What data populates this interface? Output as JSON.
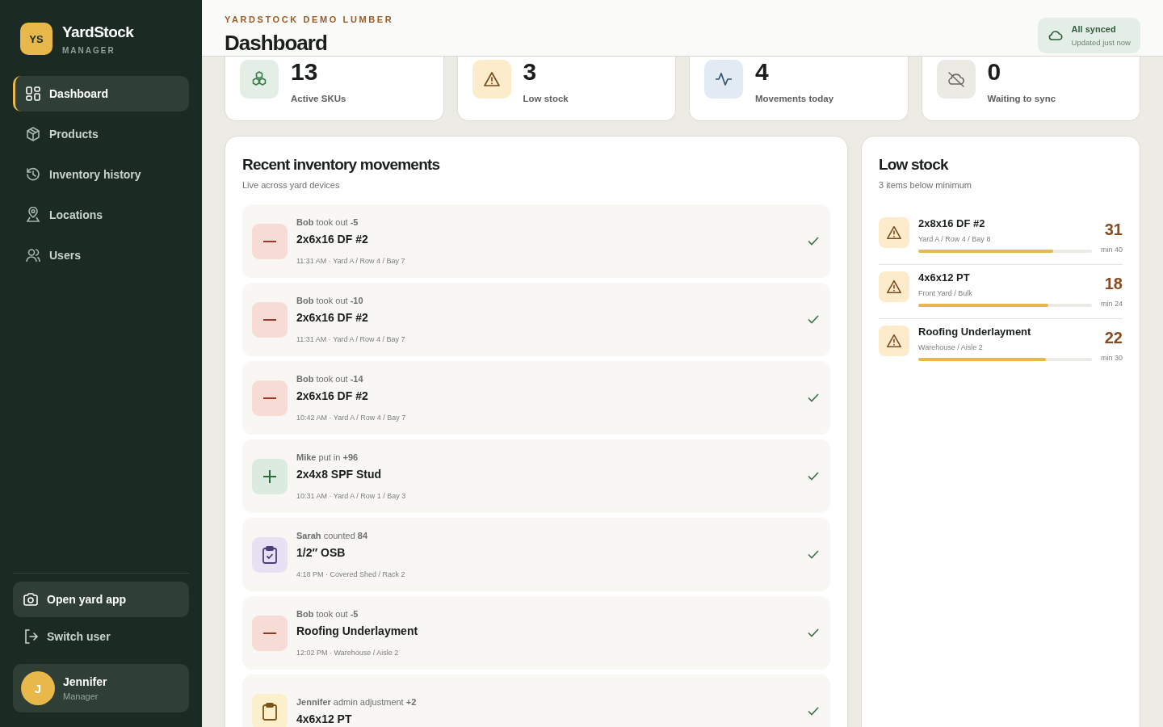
{
  "brand": {
    "logo": "YS",
    "name": "YardStock",
    "role": "MANAGER"
  },
  "nav": [
    {
      "label": "Dashboard",
      "selected": true
    },
    {
      "label": "Products",
      "selected": false
    },
    {
      "label": "Inventory history",
      "selected": false
    },
    {
      "label": "Locations",
      "selected": false
    },
    {
      "label": "Users",
      "selected": false
    }
  ],
  "open_app": "Open yard app",
  "switch_user": "Switch user",
  "user": {
    "initial": "J",
    "name": "Jennifer",
    "role": "Manager"
  },
  "header": {
    "company": "YARDSTOCK DEMO LUMBER",
    "title": "Dashboard",
    "sync": {
      "status": "All synced",
      "detail": "Updated just now"
    }
  },
  "stats": [
    {
      "kind": "skus",
      "value": "13",
      "label": "Active SKUs"
    },
    {
      "kind": "low",
      "value": "3",
      "label": "Low stock"
    },
    {
      "kind": "movements",
      "value": "4",
      "label": "Movements today"
    },
    {
      "kind": "pending",
      "value": "0",
      "label": "Waiting to sync"
    }
  ],
  "movements": {
    "title": "Recent inventory movements",
    "subtitle": "Live across yard devices",
    "items": [
      {
        "kind": "out",
        "line": "**Bob** took out **-5**",
        "product": "2x6x16 DF #2",
        "meta": "11:31 AM · Yard A / Row 4 / Bay 7",
        "synced": true
      },
      {
        "kind": "out",
        "line": "**Bob** took out **-10**",
        "product": "2x6x16 DF #2",
        "meta": "11:31 AM · Yard A / Row 4 / Bay 7",
        "synced": true
      },
      {
        "kind": "out",
        "line": "**Bob** took out **-14**",
        "product": "2x6x16 DF #2",
        "meta": "10:42 AM · Yard A / Row 4 / Bay 7",
        "synced": true
      },
      {
        "kind": "in",
        "line": "**Mike** put in **+96**",
        "product": "2x4x8 SPF Stud",
        "meta": "10:31 AM · Yard A / Row 1 / Bay 3",
        "synced": true
      },
      {
        "kind": "count",
        "line": "**Sarah** counted **84**",
        "product": "1/2″ OSB",
        "meta": "4:18 PM · Covered Shed / Rack 2",
        "synced": true
      },
      {
        "kind": "out",
        "line": "**Bob** took out **-5**",
        "product": "Roofing Underlayment",
        "meta": "12:02 PM · Warehouse / Aisle 2",
        "synced": true
      },
      {
        "kind": "adjust",
        "line": "**Jennifer** admin adjustment **+2**",
        "product": "4x6x12 PT",
        "synced": true
      }
    ]
  },
  "low_stock": {
    "title": "Low stock",
    "subtitle": "3 items below minimum",
    "items": [
      {
        "name": "2x8x16 DF #2",
        "location": "Yard A / Row 4 / Bay 8",
        "qty": "31",
        "min": "min 40",
        "level": 0.775
      },
      {
        "name": "4x6x12 PT",
        "location": "Front Yard / Bulk",
        "qty": "18",
        "min": "min 24",
        "level": 0.75
      },
      {
        "name": "Roofing Underlayment",
        "location": "Warehouse / Aisle 2",
        "qty": "22",
        "min": "min 30",
        "level": 0.733
      }
    ]
  }
}
